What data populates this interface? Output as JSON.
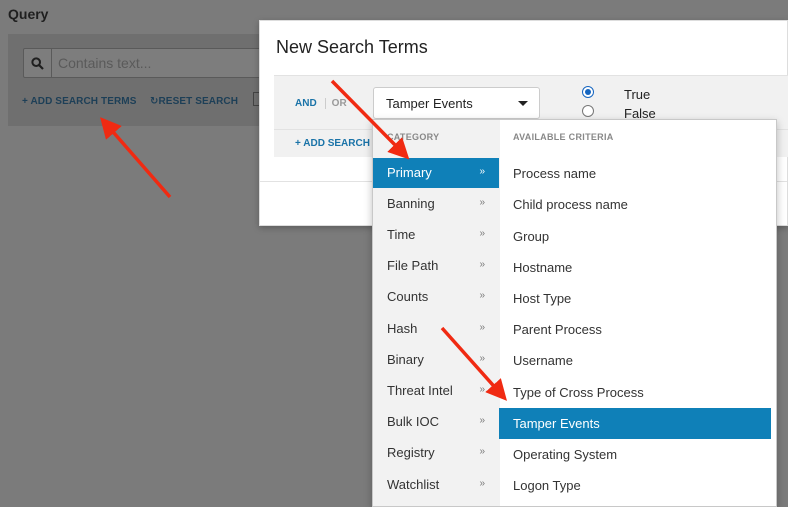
{
  "background": {
    "title": "Query",
    "search_placeholder": "Contains text...",
    "add_search_terms": "ADD SEARCH TERMS",
    "reset_search": "RESET SEARCH"
  },
  "modal": {
    "title": "New Search Terms",
    "and_label": "AND",
    "or_label": "OR",
    "selected_value": "Tamper Events",
    "radio_true": "True",
    "radio_false": "False",
    "add_search_partial": "ADD SEARCH"
  },
  "dropdown": {
    "category_header": "CATEGORY",
    "criteria_header": "AVAILABLE CRITERIA",
    "categories": [
      {
        "label": "Primary",
        "arrow": "»"
      },
      {
        "label": "Banning",
        "arrow": "»"
      },
      {
        "label": "Time",
        "arrow": "»"
      },
      {
        "label": "File Path",
        "arrow": "»"
      },
      {
        "label": "Counts",
        "arrow": "»"
      },
      {
        "label": "Hash",
        "arrow": "»"
      },
      {
        "label": "Binary",
        "arrow": "»"
      },
      {
        "label": "Threat Intel",
        "arrow": "»"
      },
      {
        "label": "Bulk IOC",
        "arrow": "»"
      },
      {
        "label": "Registry",
        "arrow": "»"
      },
      {
        "label": "Watchlist",
        "arrow": "»"
      }
    ],
    "criteria": [
      "Process name",
      "Child process name",
      "Group",
      "Hostname",
      "Host Type",
      "Parent Process",
      "Username",
      "Type of Cross Process",
      "Tamper Events",
      "Operating System",
      "Logon Type"
    ]
  },
  "colors": {
    "accent": "#0f80b8",
    "link": "#1a73a8",
    "annotation_arrow": "#f02a12"
  }
}
